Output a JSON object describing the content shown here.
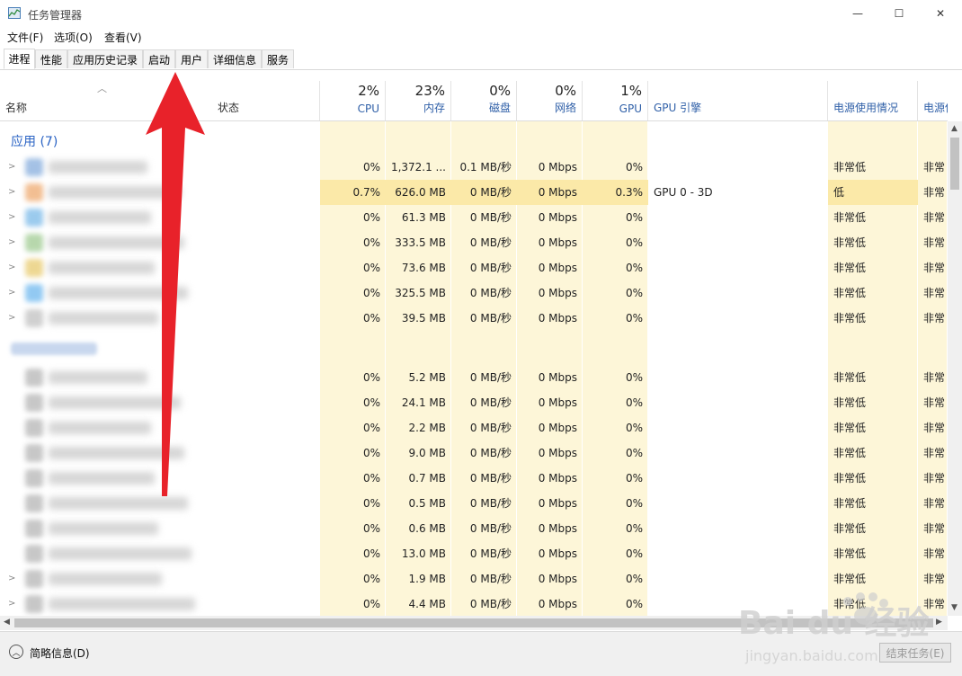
{
  "window": {
    "title": "任务管理器",
    "minimize": "—",
    "maximize": "☐",
    "close": "✕"
  },
  "menu": [
    "文件(F)",
    "选项(O)",
    "查看(V)"
  ],
  "tabs": [
    "进程",
    "性能",
    "应用历史记录",
    "启动",
    "用户",
    "详细信息",
    "服务"
  ],
  "active_tab": "进程",
  "columns": {
    "name": "名称",
    "status": "状态",
    "cpu": {
      "pct": "2%",
      "label": "CPU"
    },
    "memory": {
      "pct": "23%",
      "label": "内存"
    },
    "disk": {
      "pct": "0%",
      "label": "磁盘"
    },
    "network": {
      "pct": "0%",
      "label": "网络"
    },
    "gpu": {
      "pct": "1%",
      "label": "GPU"
    },
    "gpu_engine": "GPU 引擎",
    "power": "电源使用情况",
    "power_trend": "电源使用"
  },
  "groups": {
    "apps": "应用 (7)"
  },
  "apps": [
    {
      "cpu": "0%",
      "mem": "1,372.1 ...",
      "disk": "0.1 MB/秒",
      "net": "0 Mbps",
      "gpu": "0%",
      "engine": "",
      "power": "非常低",
      "trend": "非常"
    },
    {
      "cpu": "0.7%",
      "mem": "626.0 MB",
      "disk": "0 MB/秒",
      "net": "0 Mbps",
      "gpu": "0.3%",
      "engine": "GPU 0 - 3D",
      "power": "低",
      "trend": "非常"
    },
    {
      "cpu": "0%",
      "mem": "61.3 MB",
      "disk": "0 MB/秒",
      "net": "0 Mbps",
      "gpu": "0%",
      "engine": "",
      "power": "非常低",
      "trend": "非常"
    },
    {
      "cpu": "0%",
      "mem": "333.5 MB",
      "disk": "0 MB/秒",
      "net": "0 Mbps",
      "gpu": "0%",
      "engine": "",
      "power": "非常低",
      "trend": "非常"
    },
    {
      "cpu": "0%",
      "mem": "73.6 MB",
      "disk": "0 MB/秒",
      "net": "0 Mbps",
      "gpu": "0%",
      "engine": "",
      "power": "非常低",
      "trend": "非常"
    },
    {
      "cpu": "0%",
      "mem": "325.5 MB",
      "disk": "0 MB/秒",
      "net": "0 Mbps",
      "gpu": "0%",
      "engine": "",
      "power": "非常低",
      "trend": "非常"
    },
    {
      "cpu": "0%",
      "mem": "39.5 MB",
      "disk": "0 MB/秒",
      "net": "0 Mbps",
      "gpu": "0%",
      "engine": "",
      "power": "非常低",
      "trend": "非常"
    }
  ],
  "background": [
    {
      "cpu": "0%",
      "mem": "5.2 MB",
      "disk": "0 MB/秒",
      "net": "0 Mbps",
      "gpu": "0%",
      "power": "非常低",
      "trend": "非常"
    },
    {
      "cpu": "0%",
      "mem": "24.1 MB",
      "disk": "0 MB/秒",
      "net": "0 Mbps",
      "gpu": "0%",
      "power": "非常低",
      "trend": "非常"
    },
    {
      "cpu": "0%",
      "mem": "2.2 MB",
      "disk": "0 MB/秒",
      "net": "0 Mbps",
      "gpu": "0%",
      "power": "非常低",
      "trend": "非常"
    },
    {
      "cpu": "0%",
      "mem": "9.0 MB",
      "disk": "0 MB/秒",
      "net": "0 Mbps",
      "gpu": "0%",
      "power": "非常低",
      "trend": "非常"
    },
    {
      "cpu": "0%",
      "mem": "0.7 MB",
      "disk": "0 MB/秒",
      "net": "0 Mbps",
      "gpu": "0%",
      "power": "非常低",
      "trend": "非常"
    },
    {
      "cpu": "0%",
      "mem": "0.5 MB",
      "disk": "0 MB/秒",
      "net": "0 Mbps",
      "gpu": "0%",
      "power": "非常低",
      "trend": "非常"
    },
    {
      "cpu": "0%",
      "mem": "0.6 MB",
      "disk": "0 MB/秒",
      "net": "0 Mbps",
      "gpu": "0%",
      "power": "非常低",
      "trend": "非常"
    },
    {
      "cpu": "0%",
      "mem": "13.0 MB",
      "disk": "0 MB/秒",
      "net": "0 Mbps",
      "gpu": "0%",
      "power": "非常低",
      "trend": "非常"
    },
    {
      "cpu": "0%",
      "mem": "1.9 MB",
      "disk": "0 MB/秒",
      "net": "0 Mbps",
      "gpu": "0%",
      "power": "非常低",
      "trend": "非常"
    },
    {
      "cpu": "0%",
      "mem": "4.4 MB",
      "disk": "0 MB/秒",
      "net": "0 Mbps",
      "gpu": "0%",
      "power": "非常低",
      "trend": "非常"
    }
  ],
  "footer": {
    "fewer_details": "简略信息(D)",
    "end_task": "结束任务(E)"
  },
  "watermark": {
    "brand": "Bai du 经验",
    "url": "jingyan.baidu.com"
  },
  "colors": {
    "arrow": "#e8222a",
    "accent": "#2a63c4",
    "cell_bg": "#fdf6d8",
    "cell_highlight": "#fbe9a8"
  }
}
